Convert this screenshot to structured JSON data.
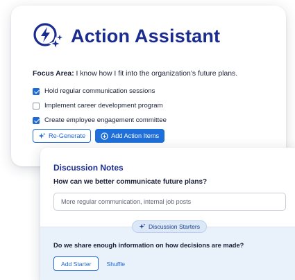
{
  "assistant": {
    "title": "Action Assistant",
    "logo_icon": "bolt-sparkle-icon",
    "focus_label": "Focus Area:",
    "focus_text": " I know how I fit into the organization’s future plans.",
    "actions": [
      {
        "label": "Hold regular communication sessions",
        "checked": true
      },
      {
        "label": "Implement career development program",
        "checked": false
      },
      {
        "label": "Create employee engagement committee",
        "checked": true
      }
    ],
    "regenerate_label": "Re-Generate",
    "add_action_items_label": "Add Action Items"
  },
  "notes": {
    "title": "Discussion Notes",
    "question": "How can we better communicate future plans?",
    "input_value": "More regular communication, internal job posts",
    "starters_label": "Discussion Starters",
    "starter_question": "Do we share enough information on how decisions are made?",
    "add_starter_label": "Add Starter",
    "shuffle_label": "Shuffle"
  },
  "colors": {
    "brand_navy": "#1b2c8f",
    "accent_blue": "#2069d6",
    "panel_tint": "#e9f1fb"
  }
}
